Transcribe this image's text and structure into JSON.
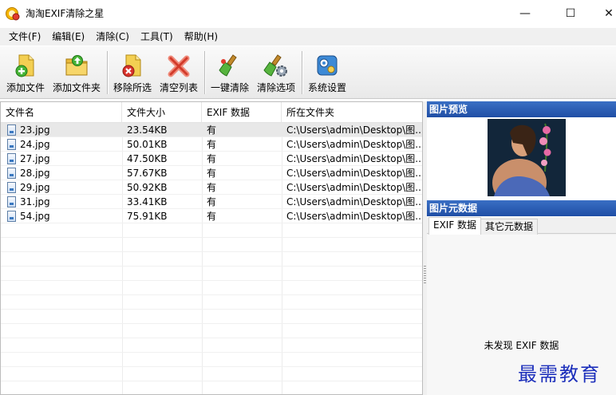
{
  "window": {
    "title": "淘淘EXIF清除之星",
    "controls": {
      "minimize": "—",
      "maximize": "☐",
      "close": "✕"
    }
  },
  "menu": [
    "文件(F)",
    "编辑(E)",
    "清除(C)",
    "工具(T)",
    "帮助(H)"
  ],
  "toolbar": {
    "add_file": "添加文件",
    "add_folder": "添加文件夹",
    "remove_selected": "移除所选",
    "clear_list": "清空列表",
    "one_click_clear": "一键清除",
    "clear_options": "清除选项",
    "settings": "系统设置"
  },
  "file_list": {
    "columns": [
      "文件名",
      "文件大小",
      "EXIF 数据",
      "所在文件夹"
    ],
    "rows": [
      {
        "name": "23.jpg",
        "size": "23.54KB",
        "exif": "有",
        "folder": "C:\\Users\\admin\\Desktop\\图..."
      },
      {
        "name": "24.jpg",
        "size": "50.01KB",
        "exif": "有",
        "folder": "C:\\Users\\admin\\Desktop\\图..."
      },
      {
        "name": "27.jpg",
        "size": "47.50KB",
        "exif": "有",
        "folder": "C:\\Users\\admin\\Desktop\\图..."
      },
      {
        "name": "28.jpg",
        "size": "57.67KB",
        "exif": "有",
        "folder": "C:\\Users\\admin\\Desktop\\图..."
      },
      {
        "name": "29.jpg",
        "size": "50.92KB",
        "exif": "有",
        "folder": "C:\\Users\\admin\\Desktop\\图..."
      },
      {
        "name": "31.jpg",
        "size": "33.41KB",
        "exif": "有",
        "folder": "C:\\Users\\admin\\Desktop\\图..."
      },
      {
        "name": "54.jpg",
        "size": "75.91KB",
        "exif": "有",
        "folder": "C:\\Users\\admin\\Desktop\\图..."
      }
    ]
  },
  "preview": {
    "title": "图片预览"
  },
  "metadata": {
    "title": "图片元数据",
    "tabs": [
      "EXIF 数据",
      "其它元数据"
    ],
    "empty_message": "未发现 EXIF 数据"
  },
  "watermark": "最需教育",
  "colors": {
    "panel_title": "#2a5bb3",
    "watermark": "#1c2fbb"
  }
}
